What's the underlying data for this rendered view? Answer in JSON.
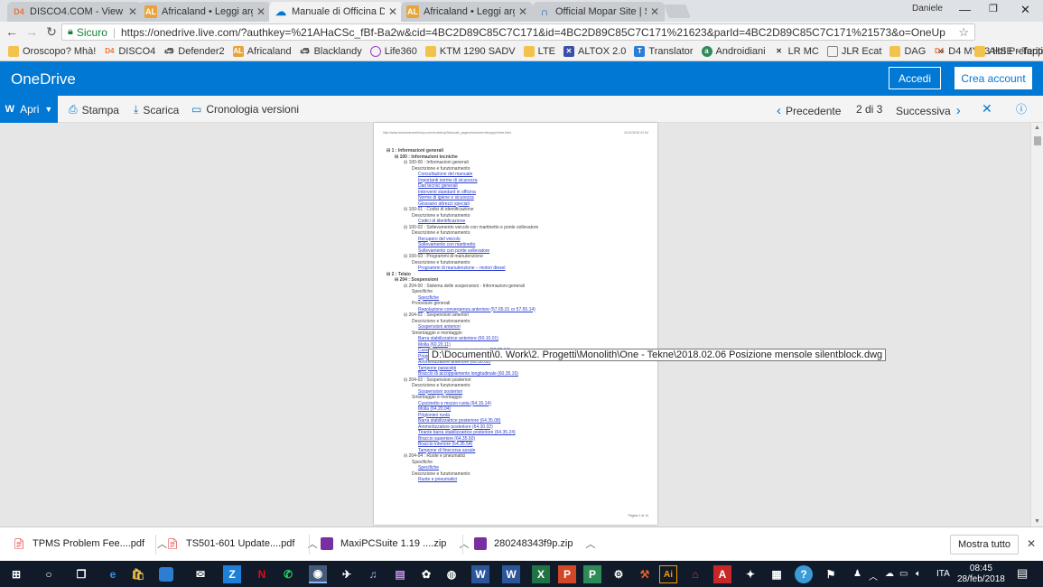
{
  "browser": {
    "tabs": [
      {
        "label": "DISCO4.COM - View topi",
        "icon": "D4",
        "icon_color": "#e8743b"
      },
      {
        "label": "Africaland • Leggi argom",
        "icon": "AL",
        "icon_color": "#e8a33b"
      },
      {
        "label": "Manuale di Officina Defe",
        "icon": "cloud",
        "icon_color": "#0078d4"
      },
      {
        "label": "Africaland • Leggi argom",
        "icon": "AL",
        "icon_color": "#e8a33b"
      },
      {
        "label": "Official Mopar Site | Serv",
        "icon": "mopar",
        "icon_color": "#1a5fb4"
      }
    ],
    "user": "Daniele",
    "secure_label": "Sicuro",
    "url": "https://onedrive.live.com/?authkey=%21AHaCSc_fBf-Ba2w&cid=4BC2D89C85C7C171&id=4BC2D89C85C7C171%21623&parId=4BC2D89C85C7C171%21573&o=OneUp",
    "bookmarks": [
      {
        "label": "Oroscopo? Mhà!",
        "icon": "folder"
      },
      {
        "label": "DISCO4",
        "icon": "D4"
      },
      {
        "label": "Defender2",
        "icon": "car"
      },
      {
        "label": "Africaland",
        "icon": "AL"
      },
      {
        "label": "Blacklandy",
        "icon": "car"
      },
      {
        "label": "Life360",
        "icon": "life"
      },
      {
        "label": "KTM 1290 SADV",
        "icon": "folder"
      },
      {
        "label": "LTE",
        "icon": "folder"
      },
      {
        "label": "ALTOX 2.0",
        "icon": "x"
      },
      {
        "label": "Translator",
        "icon": "translate"
      },
      {
        "label": "Androidiani",
        "icon": "android"
      },
      {
        "label": "LR MC",
        "icon": "x"
      },
      {
        "label": "JLR Ecat",
        "icon": "page"
      },
      {
        "label": "DAG",
        "icon": "folder"
      },
      {
        "label": "D4 MY13 HSE - Tappi",
        "icon": "D4"
      }
    ],
    "bookmarks_overflow": "»",
    "other_bookmarks": "Altri Preferiti"
  },
  "onedrive": {
    "logo": "OneDrive",
    "signin": "Accedi",
    "create_account": "Crea account",
    "toolbar": {
      "open": "Apri",
      "print": "Stampa",
      "download": "Scarica",
      "history": "Cronologia versioni",
      "previous": "Precedente",
      "page_indicator": "2 di 3",
      "next": "Successiva"
    }
  },
  "document": {
    "header_left": "http://www.landroverworkshop.com/workshop/Manuale_pages/landrover/dev/ppp/index.html",
    "header_right": "11/01/2018 02.54",
    "footer": "Pagina 1 di 14",
    "lines": [
      {
        "level": 0,
        "text": "⊟ 1 : Informazioni generali"
      },
      {
        "level": 1,
        "text": "⊟ 100 : Informazioni tecniche"
      },
      {
        "level": 2,
        "text": "⊟ 100-00 :  Informazioni generali"
      },
      {
        "level": 3,
        "text": "Descrizione e funzionamento"
      },
      {
        "level": 4,
        "text": "Consultazione del manuale"
      },
      {
        "level": 4,
        "text": "Importanti norme di sicurezza"
      },
      {
        "level": 4,
        "text": "Dati tecnici generali"
      },
      {
        "level": 4,
        "text": "Interventi standard in officina"
      },
      {
        "level": 4,
        "text": "Norme di igiene e sicurezza"
      },
      {
        "level": 4,
        "text": "Glossario attrezzi speciali"
      },
      {
        "level": 2,
        "text": "⊟ 100-01 :  Codici di identificazione"
      },
      {
        "level": 3,
        "text": "Descrizione e funzionamento"
      },
      {
        "level": 4,
        "text": "Codici di identificazione"
      },
      {
        "level": 2,
        "text": "⊟ 100-02 :  Sollevamento veicolo con martinetto e ponte sollevatore"
      },
      {
        "level": 3,
        "text": "Descrizione e funzionamento"
      },
      {
        "level": 4,
        "text": "Recupero del veicolo"
      },
      {
        "level": 4,
        "text": "Sollevamento con martinetto"
      },
      {
        "level": 4,
        "text": "Sollevamento con ponte sollevatore"
      },
      {
        "level": 2,
        "text": "⊟ 100-03 :  Programmi di manutenzione"
      },
      {
        "level": 3,
        "text": "Descrizione e funzionamento"
      },
      {
        "level": 4,
        "text": "Programmi di manutenzione – motori diesel"
      },
      {
        "level": 0,
        "text": "⊟ 2 : Telaio"
      },
      {
        "level": 1,
        "text": "⊟ 204 : Sospensioni"
      },
      {
        "level": 2,
        "text": "⊟ 204-00 :  Sistema delle sospensioni - Informazioni generali"
      },
      {
        "level": 3,
        "text": "Specifiche"
      },
      {
        "level": 4,
        "text": "Specifiche"
      },
      {
        "level": 3,
        "text": "Procedure generali"
      },
      {
        "level": 4,
        "text": "Regolazione convergenza anteriore (57.65.01 or 57.65.14)"
      },
      {
        "level": 2,
        "text": "⊟ 204-01 :  Sospensioni anteriori"
      },
      {
        "level": 3,
        "text": "Descrizione e funzionamento"
      },
      {
        "level": 4,
        "text": "Sospensioni anteriori"
      },
      {
        "level": 3,
        "text": "Smontaggio e montaggio"
      },
      {
        "level": 4,
        "text": "Barra stabilizzatrice anteriore (60.10.01)"
      },
      {
        "level": 4,
        "text": ""
      },
      {
        "level": 4,
        "text": ""
      },
      {
        "level": 4,
        "text": "Molla (60.20.11)"
      },
      {
        "level": 4,
        "text": "Cuscinetto e mozzo ruota anteriore (60.25.14)"
      },
      {
        "level": 4,
        "text": "Prigionieri ruota (60.25.22)"
      },
      {
        "level": 4,
        "text": "Ammortizzatore anteriore (60.30.02)"
      },
      {
        "level": 4,
        "text": "Tampone paracolpi"
      },
      {
        "level": 4,
        "text": "Braccio di accoppiamento longitudinale (60.35.16)"
      },
      {
        "level": 2,
        "text": "⊟ 204-02 :  Sospensioni posteriori"
      },
      {
        "level": 3,
        "text": "Descrizione e funzionamento"
      },
      {
        "level": 4,
        "text": "Sospensioni posteriori"
      },
      {
        "level": 3,
        "text": "Smontaggio e montaggio"
      },
      {
        "level": 4,
        "text": "Cuscinetto e mozzo ruota (64.15.14)"
      },
      {
        "level": 4,
        "text": "Molla (64.20.04)"
      },
      {
        "level": 4,
        "text": "Prigionieri ruota"
      },
      {
        "level": 4,
        "text": "Barra stabilizzatrice posteriore (64.35.08)"
      },
      {
        "level": 4,
        "text": "Ammortizzatore posteriore (64.30.02)"
      },
      {
        "level": 4,
        "text": "Tirante barra stabilizzatrice posteriore (64.35.24)"
      },
      {
        "level": 4,
        "text": "Braccio superiore (64.35.60)"
      },
      {
        "level": 4,
        "text": "Braccio inferiore (64.35.54)"
      },
      {
        "level": 4,
        "text": "Tampone di finecorsa assale"
      },
      {
        "level": 2,
        "text": "⊟ 204-04 :  Ruote e pneumatici"
      },
      {
        "level": 3,
        "text": "Specifiche"
      },
      {
        "level": 4,
        "text": "Specifiche"
      },
      {
        "level": 3,
        "text": "Descrizione e funzionamento"
      },
      {
        "level": 4,
        "text": "Ruote e pneumatici"
      }
    ]
  },
  "tooltip": "D:\\Documenti\\0. Work\\2. Progetti\\Monolith\\One - Tekne\\2018.02.06 Posizione mensole silentblock.dwg",
  "downloads": [
    {
      "label": "TPMS Problem Fee....pdf",
      "icon": "pdf-icon"
    },
    {
      "label": "TS501-601 Update....pdf",
      "icon": "pdf-icon"
    },
    {
      "label": "MaxiPCSuite 1.19 ....zip",
      "icon": "zip-icon"
    },
    {
      "label": "280248343f9p.zip",
      "icon": "zip-icon"
    }
  ],
  "show_all": "Mostra tutto",
  "taskbar": {
    "language": "ITA",
    "time": "08:45",
    "date": "28/feb/2018"
  }
}
